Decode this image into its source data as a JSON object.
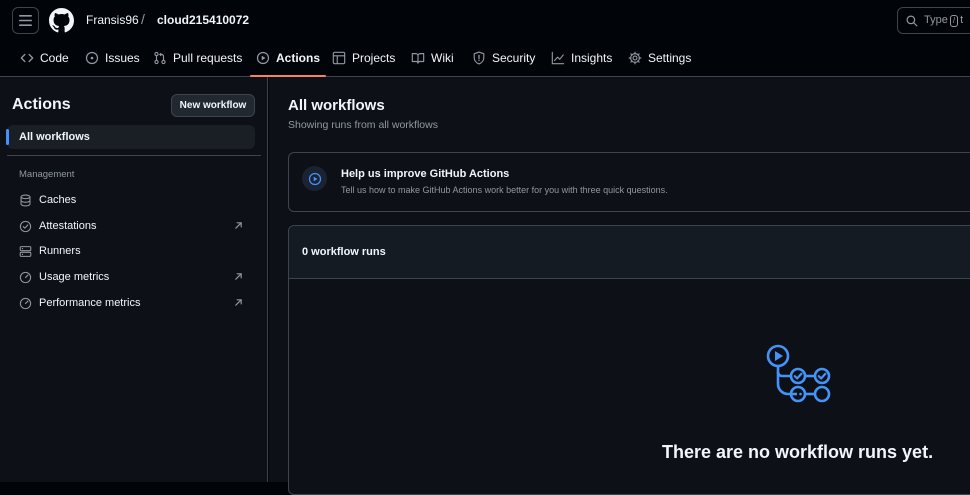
{
  "header": {
    "owner": "Fransis96",
    "separator": "/",
    "repo": "cloud215410072",
    "search_prefix": "Type",
    "search_kbd": "/",
    "search_suffix": "t"
  },
  "repo_nav": {
    "tabs": [
      {
        "label": "Code",
        "icon": "code-icon"
      },
      {
        "label": "Issues",
        "icon": "issue-opened-icon"
      },
      {
        "label": "Pull requests",
        "icon": "git-pull-request-icon"
      },
      {
        "label": "Actions",
        "icon": "play-icon",
        "active": true
      },
      {
        "label": "Projects",
        "icon": "table-icon"
      },
      {
        "label": "Wiki",
        "icon": "book-icon"
      },
      {
        "label": "Security",
        "icon": "shield-icon"
      },
      {
        "label": "Insights",
        "icon": "graph-icon"
      },
      {
        "label": "Settings",
        "icon": "gear-icon"
      }
    ]
  },
  "sidebar": {
    "title": "Actions",
    "new_workflow_label": "New workflow",
    "all_workflows_label": "All workflows",
    "section_label": "Management",
    "items": [
      {
        "label": "Caches",
        "icon": "database-icon",
        "external": false
      },
      {
        "label": "Attestations",
        "icon": "verified-icon",
        "external": true
      },
      {
        "label": "Runners",
        "icon": "server-icon",
        "external": false
      },
      {
        "label": "Usage metrics",
        "icon": "meter-icon",
        "external": true
      },
      {
        "label": "Performance metrics",
        "icon": "meter-icon",
        "external": true
      }
    ]
  },
  "main": {
    "title": "All workflows",
    "subtitle": "Showing runs from all workflows",
    "banner": {
      "title": "Help us improve GitHub Actions",
      "description": "Tell us how to make GitHub Actions work better for you with three quick questions."
    },
    "runs_count_label": "0 workflow runs",
    "empty_state": "There are no workflow runs yet."
  },
  "colors": {
    "background": "#010409",
    "canvas": "#0d1117",
    "border": "#3d444d",
    "accent": "#4493f8",
    "active_tab_underline": "#f78166",
    "muted_text": "#9198a1"
  }
}
